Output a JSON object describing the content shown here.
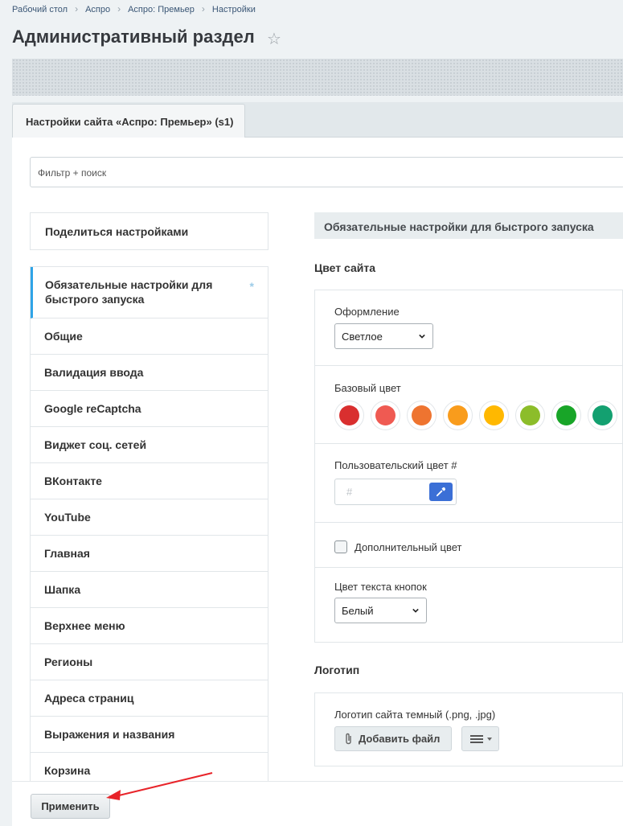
{
  "breadcrumb": [
    "Рабочий стол",
    "Аспро",
    "Аспро: Премьер",
    "Настройки"
  ],
  "page": {
    "title": "Административный раздел"
  },
  "tab": {
    "label": "Настройки сайта «Аспро: Премьер» (s1)"
  },
  "filter": {
    "placeholder": "Фильтр + поиск"
  },
  "sidebar": {
    "share_label": "Поделиться настройками",
    "items": [
      "Обязательные настройки для быстрого запуска",
      "Общие",
      "Валидация ввода",
      "Google reCaptcha",
      "Виджет соц. сетей",
      "ВКонтакте",
      "YouTube",
      "Главная",
      "Шапка",
      "Верхнее меню",
      "Регионы",
      "Адреса страниц",
      "Выражения и названия",
      "Корзина"
    ],
    "active_index": 0
  },
  "main": {
    "header": "Обязательные настройки для быстрого запуска",
    "color_section": {
      "title": "Цвет сайта",
      "design_label": "Оформление",
      "design_value": "Светлое",
      "base_color_label": "Базовый цвет",
      "swatches": [
        "#d92f2f",
        "#ef5a52",
        "#ee7430",
        "#f99c1c",
        "#ffb800",
        "#8cbd2a",
        "#18a528",
        "#13a070"
      ],
      "custom_color_label": "Пользовательский цвет #",
      "custom_color_placeholder": "#",
      "extra_color_label": "Дополнительный цвет",
      "button_text_color_label": "Цвет текста кнопок",
      "button_text_color_value": "Белый"
    },
    "logo_section": {
      "title": "Логотип",
      "dark_logo_label": "Логотип сайта темный (.png, .jpg)",
      "add_file_label": "Добавить файл"
    }
  },
  "footer": {
    "apply_label": "Применить"
  },
  "colors": {
    "accent": "#2fa4e7",
    "annotation": "#e8242a",
    "pick_button": "#3b6fd6"
  }
}
